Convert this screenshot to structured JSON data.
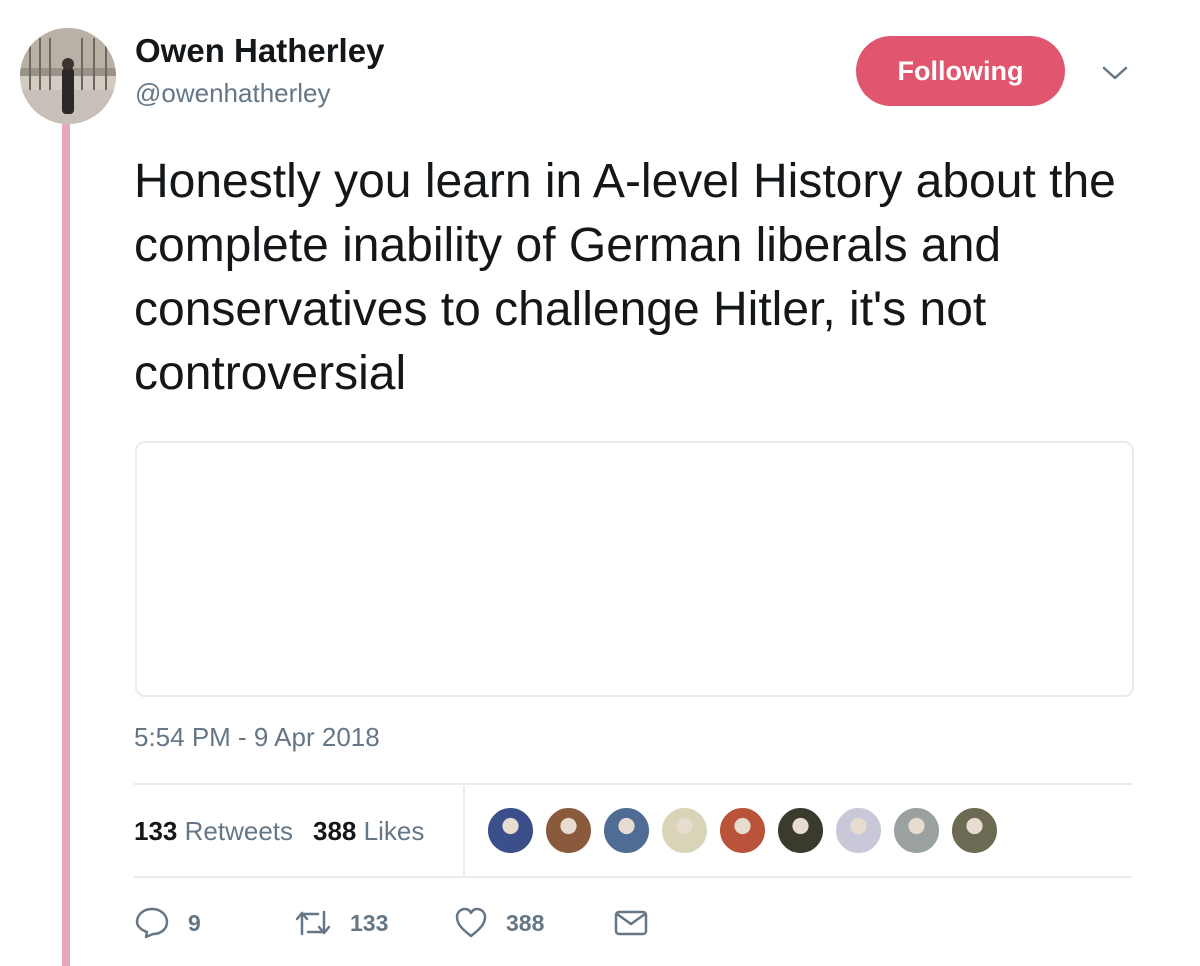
{
  "tweet": {
    "author": {
      "name": "Owen Hatherley",
      "handle": "@owenhatherley"
    },
    "follow_button_label": "Following",
    "text": "Honestly you learn in A-level History about the complete inability of German liberals and conservatives to challenge Hitler, it's not controversial",
    "timestamp": "5:54 PM - 9 Apr 2018",
    "stats": {
      "retweets_count": "133",
      "retweets_label": "Retweets",
      "likes_count": "388",
      "likes_label": "Likes"
    },
    "likers": [
      {
        "color": "#3b4f8a"
      },
      {
        "color": "#8a5a3c"
      },
      {
        "color": "#4f6c94"
      },
      {
        "color": "#d8d4b8"
      },
      {
        "color": "#b9533a"
      },
      {
        "color": "#3a3a2e"
      },
      {
        "color": "#c8c8d8"
      },
      {
        "color": "#9aa1a0"
      },
      {
        "color": "#6c6a52"
      }
    ],
    "actions": {
      "reply_count": "9",
      "retweet_count": "133",
      "like_count": "388"
    }
  },
  "colors": {
    "accent": "#e0566f",
    "thread_line": "#e8a8bb",
    "secondary_text": "#657786"
  },
  "icons": [
    "chevron-down-icon",
    "reply-icon",
    "retweet-icon",
    "heart-icon",
    "mail-icon"
  ]
}
